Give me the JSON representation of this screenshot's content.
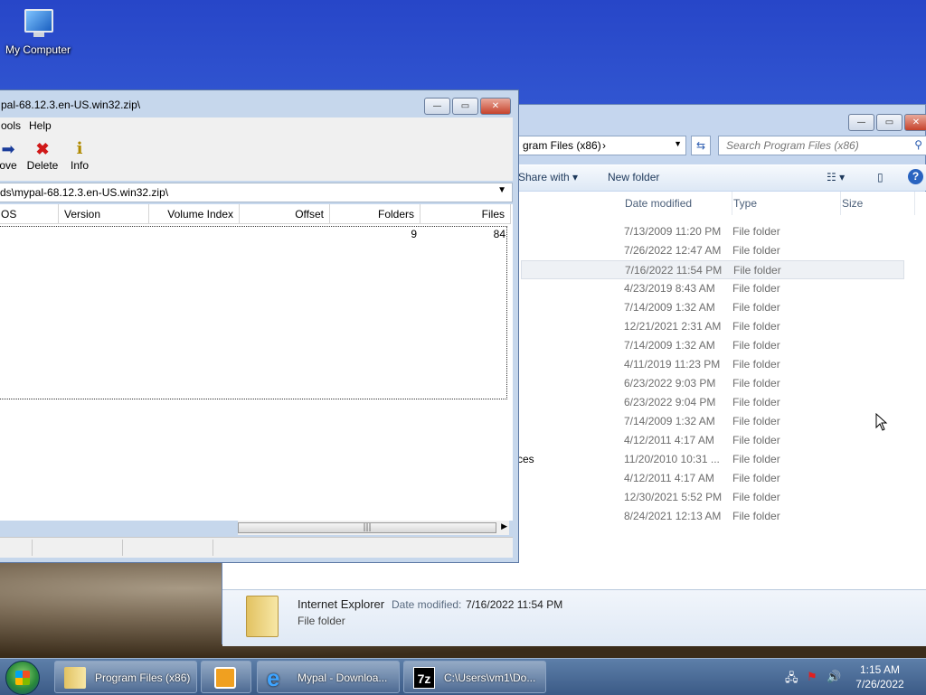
{
  "desktop": {
    "icon_label": "My Computer"
  },
  "explorer": {
    "address": "gram Files (x86)",
    "search_placeholder": "Search Program Files (x86)",
    "commands": {
      "share_with": "Share with",
      "new_folder": "New folder"
    },
    "columns": {
      "date": "Date modified",
      "type": "Type",
      "size": "Size"
    },
    "rows": [
      {
        "name": "",
        "date": "7/13/2009 11:20 PM",
        "type": "File folder"
      },
      {
        "name": "",
        "date": "7/26/2022 12:47 AM",
        "type": "File folder"
      },
      {
        "name": "",
        "date": "7/16/2022 11:54 PM",
        "type": "File folder"
      },
      {
        "name": "",
        "date": "4/23/2019 8:43 AM",
        "type": "File folder"
      },
      {
        "name": "",
        "date": "7/14/2009 1:32 AM",
        "type": "File folder"
      },
      {
        "name": "",
        "date": "12/21/2021 2:31 AM",
        "type": "File folder"
      },
      {
        "name": "",
        "date": "7/14/2009 1:32 AM",
        "type": "File folder"
      },
      {
        "name": "",
        "date": "4/11/2019 11:23 PM",
        "type": "File folder"
      },
      {
        "name": "",
        "date": "6/23/2022 9:03 PM",
        "type": "File folder"
      },
      {
        "name": "",
        "date": "6/23/2022 9:04 PM",
        "type": "File folder"
      },
      {
        "name": "",
        "date": "7/14/2009 1:32 AM",
        "type": "File folder"
      },
      {
        "name": "",
        "date": "4/12/2011 4:17 AM",
        "type": "File folder"
      },
      {
        "name": "ces",
        "date": "11/20/2010 10:31 ...",
        "type": "File folder"
      },
      {
        "name": "",
        "date": "4/12/2011 4:17 AM",
        "type": "File folder"
      },
      {
        "name": "",
        "date": "12/30/2021 5:52 PM",
        "type": "File folder"
      },
      {
        "name": "",
        "date": "8/24/2021 12:13 AM",
        "type": "File folder"
      }
    ],
    "details": {
      "name": "Internet Explorer",
      "date_label": "Date modified:",
      "date_value": "7/16/2022 11:54 PM",
      "type": "File folder"
    }
  },
  "zip": {
    "title": "pal-68.12.3.en-US.win32.zip\\",
    "menu": {
      "tools": "ools",
      "help": "Help"
    },
    "toolbar": {
      "move": "ove",
      "delete": "Delete",
      "info": "Info"
    },
    "path": "ds\\mypal-68.12.3.en-US.win32.zip\\",
    "columns": {
      "os": "OS",
      "version": "Version",
      "volume_index": "Volume Index",
      "offset": "Offset",
      "folders": "Folders",
      "files": "Files"
    },
    "row": {
      "folders": "9",
      "files": "84"
    }
  },
  "taskbar": {
    "items": [
      {
        "label": "Program Files (x86)"
      },
      {
        "label": ""
      },
      {
        "label": "Mypal - Downloa..."
      },
      {
        "label": "C:\\Users\\vm1\\Do..."
      }
    ],
    "time": "1:15 AM",
    "date": "7/26/2022"
  }
}
